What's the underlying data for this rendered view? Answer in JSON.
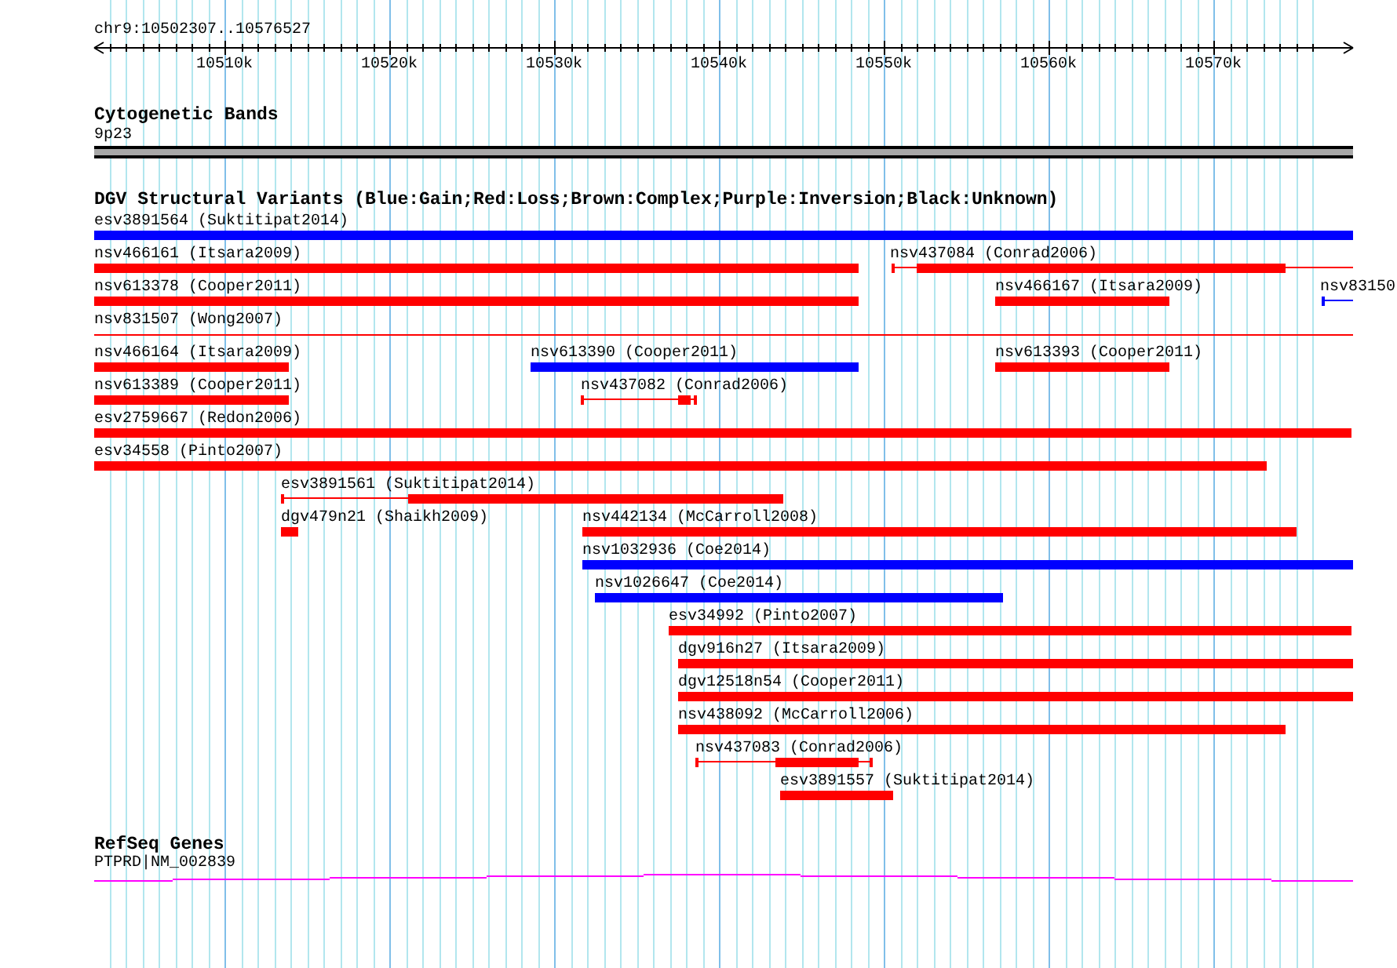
{
  "ruler": {
    "location": "chr9:10502307..10576527",
    "ticks": [
      "10510k",
      "10520k",
      "10530k",
      "10540k",
      "10550k",
      "10560k",
      "10570k"
    ]
  },
  "cytogenetic_bands": {
    "title": "Cytogenetic Bands",
    "band": "9p23"
  },
  "dgv": {
    "title": "DGV Structural Variants (Blue:Gain;Red:Loss;Brown:Complex;Purple:Inversion;Black:Unknown)",
    "features": [
      {
        "label": "esv3891564 (Suktitipat2014)",
        "color": "#0000ff",
        "kind": "bar"
      },
      {
        "label": "nsv466161 (Itsara2009)",
        "color": "#ff0000",
        "kind": "bar"
      },
      {
        "label": "nsv437084 (Conrad2006)",
        "color": "#ff0000",
        "kind": "span"
      },
      {
        "label": "nsv613378 (Cooper2011)",
        "color": "#ff0000",
        "kind": "bar"
      },
      {
        "label": "nsv466167 (Itsara2009)",
        "color": "#ff0000",
        "kind": "bar"
      },
      {
        "label": "nsv83150",
        "color": "#0000ff",
        "kind": "span"
      },
      {
        "label": "nsv831507 (Wong2007)",
        "color": "#ff0000",
        "kind": "line"
      },
      {
        "label": "nsv466164 (Itsara2009)",
        "color": "#ff0000",
        "kind": "bar"
      },
      {
        "label": "nsv613390 (Cooper2011)",
        "color": "#0000ff",
        "kind": "bar"
      },
      {
        "label": "nsv613393 (Cooper2011)",
        "color": "#ff0000",
        "kind": "bar"
      },
      {
        "label": "nsv613389 (Cooper2011)",
        "color": "#ff0000",
        "kind": "bar"
      },
      {
        "label": "nsv437082 (Conrad2006)",
        "color": "#ff0000",
        "kind": "span"
      },
      {
        "label": "esv2759667 (Redon2006)",
        "color": "#ff0000",
        "kind": "bar"
      },
      {
        "label": "esv34558 (Pinto2007)",
        "color": "#ff0000",
        "kind": "bar"
      },
      {
        "label": "esv3891561 (Suktitipat2014)",
        "color": "#ff0000",
        "kind": "span"
      },
      {
        "label": "dgv479n21 (Shaikh2009)",
        "color": "#ff0000",
        "kind": "bar"
      },
      {
        "label": "nsv442134 (McCarroll2008)",
        "color": "#ff0000",
        "kind": "bar"
      },
      {
        "label": "nsv1032936 (Coe2014)",
        "color": "#0000ff",
        "kind": "bar"
      },
      {
        "label": "nsv1026647 (Coe2014)",
        "color": "#0000ff",
        "kind": "bar"
      },
      {
        "label": "esv34992 (Pinto2007)",
        "color": "#ff0000",
        "kind": "bar"
      },
      {
        "label": "dgv916n27 (Itsara2009)",
        "color": "#ff0000",
        "kind": "bar"
      },
      {
        "label": "dgv12518n54 (Cooper2011)",
        "color": "#ff0000",
        "kind": "bar"
      },
      {
        "label": "nsv438092 (McCarroll2006)",
        "color": "#ff0000",
        "kind": "bar"
      },
      {
        "label": "nsv437083 (Conrad2006)",
        "color": "#ff0000",
        "kind": "span"
      },
      {
        "label": "esv3891557 (Suktitipat2014)",
        "color": "#ff0000",
        "kind": "bar"
      }
    ]
  },
  "refseq_genes": {
    "title": "RefSeq Genes",
    "gene": "PTPRD|NM_002839"
  }
}
